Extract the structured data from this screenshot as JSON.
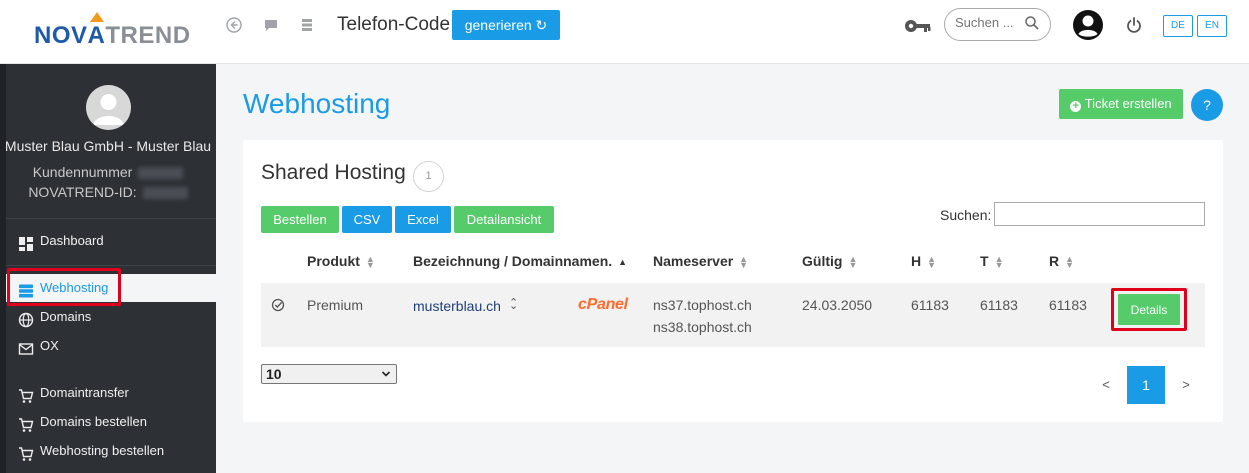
{
  "header": {
    "logo_part1": "NOV",
    "logo_wedge": "A",
    "logo_part2": "TREND",
    "title": "Telefon-Code",
    "generate_button": "generieren ↻",
    "search_placeholder": "Suchen ...",
    "lang_de": "DE",
    "lang_en": "EN"
  },
  "sidebar": {
    "company": "Muster Blau GmbH - Muster Blau",
    "customer_number_label": "Kundennummer",
    "novatrend_id_label": "NOVATREND-ID:",
    "items": [
      {
        "label": "Dashboard",
        "icon": "dashboard-icon"
      },
      {
        "label": "Webhosting",
        "icon": "server-icon",
        "active": true
      },
      {
        "label": "Domains",
        "icon": "globe-icon"
      },
      {
        "label": "OX",
        "icon": "mail-icon"
      },
      {
        "label": "Domaintransfer",
        "icon": "cart-icon"
      },
      {
        "label": "Domains bestellen",
        "icon": "cart-icon"
      },
      {
        "label": "Webhosting bestellen",
        "icon": "cart-icon"
      }
    ]
  },
  "main": {
    "page_title": "Webhosting",
    "ticket_button": "Ticket erstellen",
    "help_button": "?",
    "card_title": "Shared Hosting",
    "count": "1",
    "toolbar": {
      "order": "Bestellen",
      "csv": "CSV",
      "excel": "Excel",
      "detail_view": "Detailansicht"
    },
    "search_label": "Suchen:",
    "table": {
      "headers": [
        "Produkt",
        "Bezeichnung / Domainnamen.",
        "Nameserver",
        "Gültig",
        "H",
        "T",
        "R"
      ],
      "rows": [
        {
          "product": "Premium",
          "domain": "musterblau.ch",
          "panel": "cPanel",
          "ns1": "ns37.tophost.ch",
          "ns2": "ns38.tophost.ch",
          "valid": "24.03.2050",
          "h": "61183",
          "t": "61183",
          "r": "61183",
          "action": "Details"
        }
      ]
    },
    "page_size": "10",
    "pagination": {
      "prev": "<",
      "current": "1",
      "next": ">"
    }
  },
  "colors": {
    "accent": "#1a9be6",
    "success": "#55cb6a",
    "sidebar": "#2d3035",
    "highlight": "#e0001b",
    "cpanel": "#ff6c2c"
  }
}
